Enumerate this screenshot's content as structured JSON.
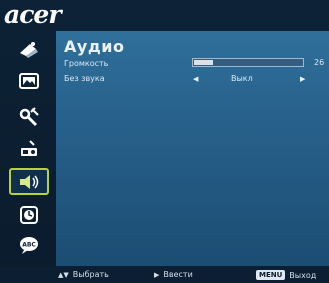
{
  "brand": {
    "logo_text": "acer"
  },
  "sidebar": {
    "items": [
      {
        "name": "image-settings-icon",
        "active": false
      },
      {
        "name": "picture-icon",
        "active": false
      },
      {
        "name": "tools-settings-icon",
        "active": false
      },
      {
        "name": "projector-icon",
        "active": false
      },
      {
        "name": "audio-icon",
        "active": true
      },
      {
        "name": "timer-icon",
        "active": false
      },
      {
        "name": "language-icon",
        "active": false
      }
    ]
  },
  "panel": {
    "title": "Аудио",
    "volume": {
      "label": "Громкость",
      "value": "26",
      "level_fraction": 0.18
    },
    "mute": {
      "label": "Без звука",
      "value": "Выкл"
    }
  },
  "footer": {
    "select_label": "Выбрать",
    "enter_label": "Ввести",
    "menu_key": "MENU",
    "exit_label": "Выход"
  },
  "colors": {
    "accent_active": "#b7d33b",
    "panel_bg": "#2f6f9a",
    "sidebar_bg": "#0d2236"
  }
}
